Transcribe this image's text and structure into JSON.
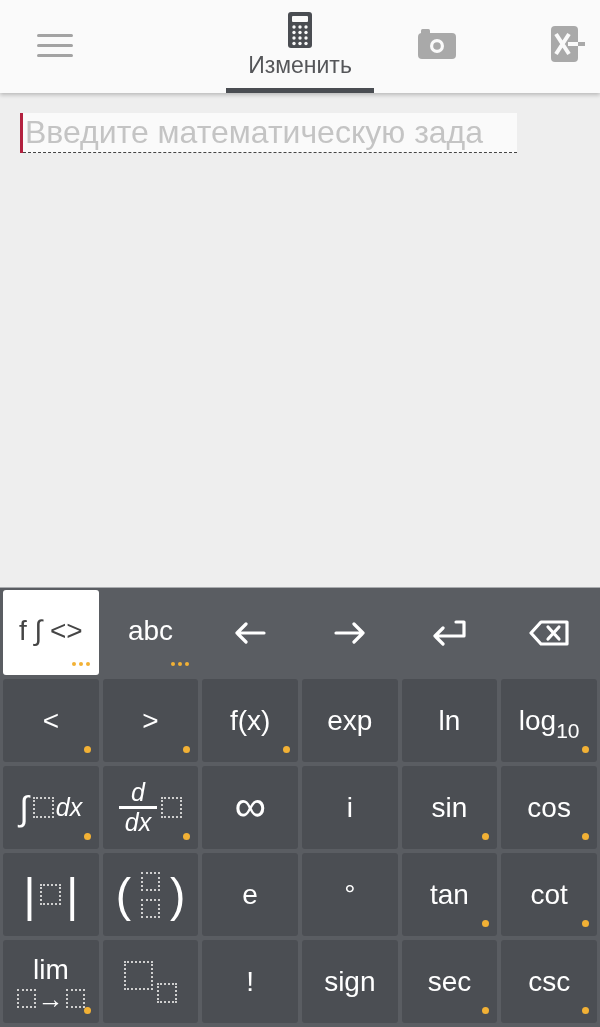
{
  "top_bar": {
    "tabs": [
      {
        "kind": "calculator",
        "label": "Изменить",
        "selected": true
      },
      {
        "kind": "camera",
        "selected": false
      },
      {
        "kind": "variables",
        "selected": false
      }
    ]
  },
  "editor": {
    "placeholder": "Введите математическую зада",
    "focused": true
  },
  "keyboard": {
    "modes": [
      {
        "label": "f ∫ <>",
        "selected": true,
        "more": true
      },
      {
        "label": "abc",
        "selected": false,
        "more": true
      }
    ],
    "actions": [
      {
        "kind": "left"
      },
      {
        "kind": "right"
      },
      {
        "kind": "enter"
      },
      {
        "kind": "backspace"
      }
    ],
    "keys": [
      {
        "kind": "text",
        "label": "<",
        "more": true
      },
      {
        "kind": "text",
        "label": ">",
        "more": true
      },
      {
        "kind": "text",
        "label": "f(x)",
        "more": true
      },
      {
        "kind": "text",
        "label": "exp",
        "more": false
      },
      {
        "kind": "text",
        "label": "ln",
        "more": false
      },
      {
        "kind": "text",
        "label": "log$_{10}$",
        "more": true
      },
      {
        "kind": "integral",
        "symbol": "∫",
        "label": "dx",
        "more": true
      },
      {
        "kind": "derivative",
        "numerator": "d",
        "denominator": "dx",
        "more": true
      },
      {
        "kind": "symbol",
        "label": "∞",
        "more": false
      },
      {
        "kind": "text",
        "label": "i",
        "more": false
      },
      {
        "kind": "text",
        "label": "sin",
        "more": true
      },
      {
        "kind": "text",
        "label": "cos",
        "more": true
      },
      {
        "kind": "abs",
        "left": "|",
        "right": "|",
        "more": false
      },
      {
        "kind": "binomial",
        "left": "(",
        "right": ")",
        "more": false
      },
      {
        "kind": "text",
        "label": "e",
        "more": false
      },
      {
        "kind": "text",
        "label": "°",
        "more": false
      },
      {
        "kind": "text",
        "label": "tan",
        "more": true
      },
      {
        "kind": "text",
        "label": "cot",
        "more": true
      },
      {
        "kind": "limit",
        "label": "lim",
        "arrow": "→",
        "more": true
      },
      {
        "kind": "subscript",
        "more": false
      },
      {
        "kind": "text",
        "label": "!",
        "more": false
      },
      {
        "kind": "text",
        "label": "sign",
        "more": false
      },
      {
        "kind": "text",
        "label": "sec",
        "more": true
      },
      {
        "kind": "text",
        "label": "csc",
        "more": true
      }
    ]
  }
}
